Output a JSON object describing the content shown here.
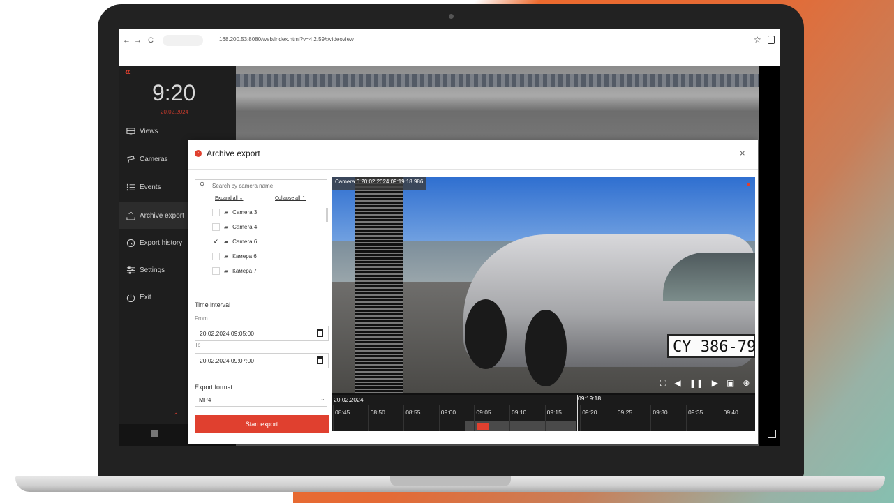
{
  "browser": {
    "back": "←",
    "forward": "→",
    "reload": "C",
    "url": "168.200.53:8080/web/index.html?v=4.2.59#/videoview",
    "bookmark": "☆"
  },
  "sidebar": {
    "collapse": "«",
    "time": "9:20",
    "date": "20.02.2024",
    "items": [
      {
        "label": "Views",
        "icon": "views-icon"
      },
      {
        "label": "Cameras",
        "icon": "camera-icon"
      },
      {
        "label": "Events",
        "icon": "events-icon"
      },
      {
        "label": "Archive export",
        "icon": "export-icon"
      },
      {
        "label": "Export history",
        "icon": "history-icon"
      },
      {
        "label": "Settings",
        "icon": "settings-icon"
      },
      {
        "label": "Exit",
        "icon": "power-icon"
      }
    ],
    "up_arrow": "⌃"
  },
  "modal": {
    "title": "Archive export",
    "close": "×",
    "search_placeholder": "Search by camera name",
    "expand_all": "Expand all ⌄",
    "collapse_all": "Collapse all ⌃",
    "cameras": [
      {
        "name": "Camera 3",
        "checked": false
      },
      {
        "name": "Camera 4",
        "checked": false
      },
      {
        "name": "Camera 6",
        "checked": true
      },
      {
        "name": "Камера 6",
        "checked": false
      },
      {
        "name": "Камера 7",
        "checked": false
      }
    ],
    "time_interval_label": "Time interval",
    "from_label": "From",
    "from_value": "20.02.2024 09:05:00",
    "to_label": "To",
    "to_value": "20.02.2024 09:07:00",
    "export_format_label": "Export format",
    "export_format_value": "MP4",
    "start_button": "Start export"
  },
  "player": {
    "overlay_label": "Camera 6 20.02.2024 09:19:18.986",
    "plate_text": "CY 386-79",
    "timeline": {
      "date": "20.02.2024",
      "current": "09:19:18",
      "ticks": [
        "08:45",
        "08:50",
        "08:55",
        "09:00",
        "09:05",
        "09:10",
        "09:15",
        "09:20",
        "09:25",
        "09:30",
        "09:35",
        "09:40"
      ]
    }
  },
  "colors": {
    "accent": "#e0402f",
    "sidebar_bg": "#1e1e1e"
  }
}
